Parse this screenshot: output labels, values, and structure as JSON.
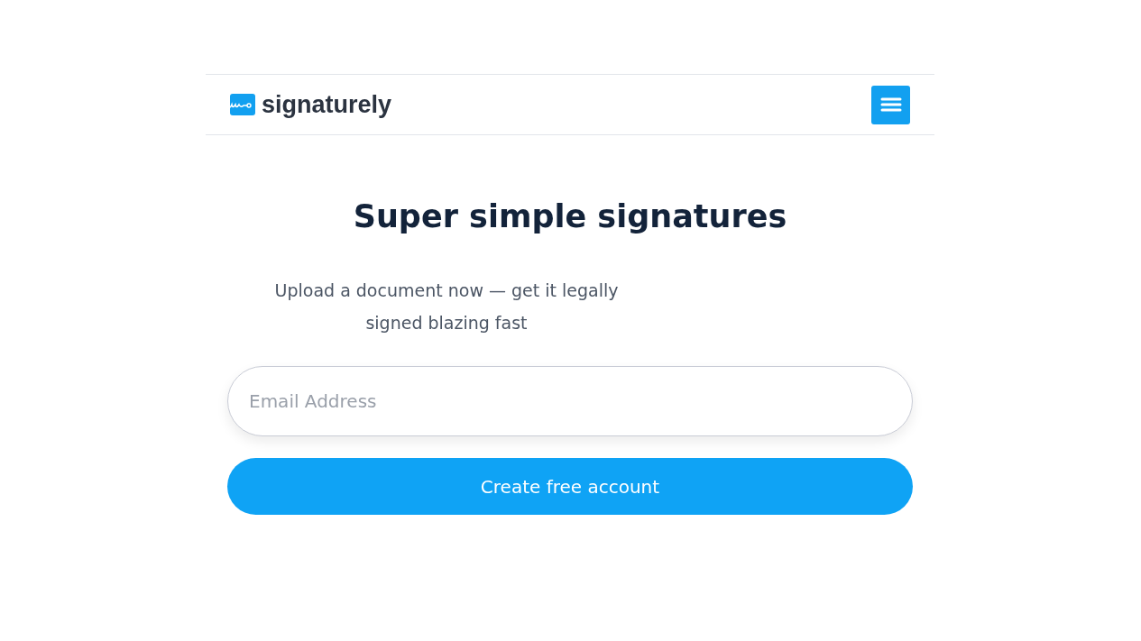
{
  "header": {
    "logo_text": "signaturely",
    "menu_button": {
      "expanded": false
    }
  },
  "hero": {
    "title": "Super simple signatures",
    "subtitle": "Upload a document now — get it legally signed blazing fast"
  },
  "signup_form": {
    "email_field": {
      "placeholder": "Email Address"
    },
    "submit_button": "Create free account"
  }
}
